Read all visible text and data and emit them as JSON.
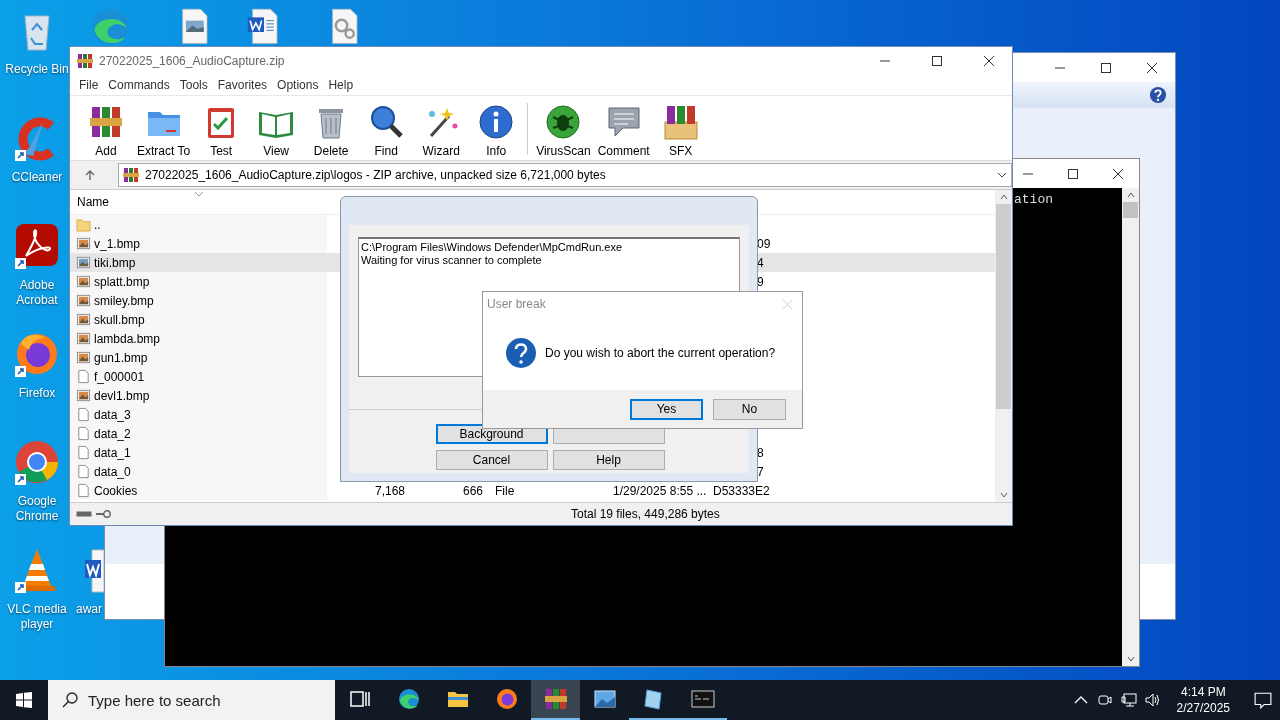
{
  "desktop": {
    "icons": [
      {
        "kind": "recycle",
        "label": "Recycle Bin"
      },
      {
        "kind": "ccleaner",
        "label": "CCleaner"
      },
      {
        "kind": "acrobat",
        "label": "Adobe Acrobat"
      },
      {
        "kind": "firefox",
        "label": "Firefox"
      },
      {
        "kind": "chrome",
        "label": "Google Chrome"
      },
      {
        "kind": "vlc",
        "label": "VLC media player"
      }
    ],
    "top_icons": [
      {
        "kind": "edge"
      },
      {
        "kind": "image"
      },
      {
        "kind": "word"
      },
      {
        "kind": "settings"
      }
    ],
    "partial_icon": {
      "kind": "word",
      "label": "awar"
    }
  },
  "console": {
    "text": "ation"
  },
  "winrar": {
    "title": "27022025_1606_AudioCapture.zip",
    "menu": [
      "File",
      "Commands",
      "Tools",
      "Favorites",
      "Options",
      "Help"
    ],
    "toolbar": [
      {
        "kind": "add",
        "label": "Add"
      },
      {
        "kind": "extract",
        "label": "Extract To"
      },
      {
        "kind": "test",
        "label": "Test"
      },
      {
        "kind": "view",
        "label": "View"
      },
      {
        "kind": "delete",
        "label": "Delete"
      },
      {
        "kind": "find",
        "label": "Find"
      },
      {
        "kind": "wizard",
        "label": "Wizard"
      },
      {
        "kind": "info",
        "label": "Info"
      },
      {
        "kind": "virusscan",
        "label": "VirusScan"
      },
      {
        "kind": "comment",
        "label": "Comment"
      },
      {
        "kind": "sfx",
        "label": "SFX"
      }
    ],
    "address": "27022025_1606_AudioCapture.zip\\logos - ZIP archive, unpacked size 6,721,000 bytes",
    "columns": [
      "Name"
    ],
    "rows": [
      {
        "name": "..",
        "kind": "folder",
        "selected": false
      },
      {
        "name": "v_1.bmp",
        "kind": "bitmap",
        "selected": false,
        "crc_part": "09"
      },
      {
        "name": "tiki.bmp",
        "kind": "bitmap",
        "selected": true,
        "crc_part": "4"
      },
      {
        "name": "splatt.bmp",
        "kind": "bitmap",
        "selected": false,
        "crc_part": "9"
      },
      {
        "name": "smiley.bmp",
        "kind": "bitmap",
        "selected": false
      },
      {
        "name": "skull.bmp",
        "kind": "bitmap",
        "selected": false
      },
      {
        "name": "lambda.bmp",
        "kind": "bitmap",
        "selected": false
      },
      {
        "name": "gun1.bmp",
        "kind": "bitmap",
        "selected": false
      },
      {
        "name": "f_000001",
        "kind": "file",
        "selected": false
      },
      {
        "name": "devl1.bmp",
        "kind": "bitmap",
        "selected": false
      },
      {
        "name": "data_3",
        "kind": "file",
        "selected": false
      },
      {
        "name": "data_2",
        "kind": "file",
        "selected": false
      },
      {
        "name": "data_1",
        "kind": "file",
        "selected": false,
        "crc_part": "8"
      },
      {
        "name": "data_0",
        "kind": "file",
        "selected": false,
        "crc_part": "7"
      },
      {
        "name": "Cookies",
        "kind": "file",
        "selected": false,
        "size": "7,168",
        "packed": "666",
        "type": "File",
        "modified": "1/29/2025 8:55 ...",
        "crc": "D53333E2"
      }
    ],
    "status": "Total 19 files, 449,286 bytes"
  },
  "progress_dialog": {
    "log": [
      "C:\\Program Files\\Windows Defender\\MpCmdRun.exe",
      "Waiting for virus scanner to complete"
    ],
    "buttons": [
      {
        "label": "Background",
        "selected": true
      },
      {
        "selected": false
      },
      {
        "label": "Cancel",
        "selected": false
      },
      {
        "label": "Help",
        "selected": false
      }
    ]
  },
  "user_break": {
    "title": "User break",
    "message": "Do you wish to abort the current operation?",
    "buttons": [
      {
        "label": "Yes",
        "selected": true
      },
      {
        "label": "No",
        "selected": false
      }
    ]
  },
  "taskbar": {
    "search": {
      "placeholder": "Type here to search"
    },
    "apps": [
      {
        "kind": "taskview",
        "selected": false,
        "running": false
      },
      {
        "kind": "edge",
        "selected": false,
        "running": false
      },
      {
        "kind": "explorer",
        "selected": false,
        "running": false
      },
      {
        "kind": "firefox",
        "selected": false,
        "running": false
      },
      {
        "kind": "winrar",
        "selected": true,
        "running": true
      },
      {
        "kind": "photos",
        "selected": false,
        "running": false
      },
      {
        "kind": "notepad",
        "selected": false,
        "running": true
      },
      {
        "kind": "cmd",
        "selected": false,
        "running": true
      }
    ],
    "clock": {
      "time": "4:14 PM",
      "date": "2/27/2025"
    }
  }
}
